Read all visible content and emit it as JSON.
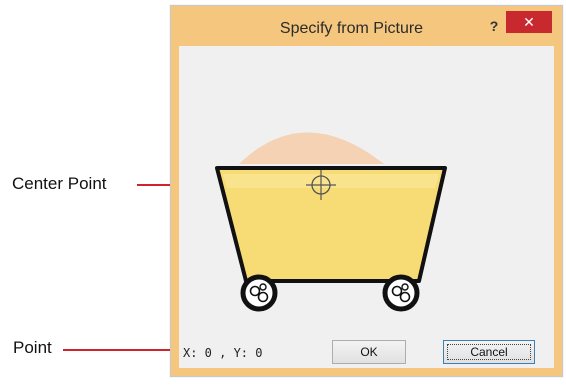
{
  "callouts": {
    "center_point": "Center Point",
    "point": "Point"
  },
  "dialog": {
    "title": "Specify from Picture",
    "help_label": "?",
    "close_label": "✕",
    "coordinates": "X: 0 , Y: 0",
    "ok_label": "OK",
    "cancel_label": "Cancel"
  },
  "colors": {
    "frame": "#f4c67e",
    "callout_line": "#d0232b",
    "close_button": "#c7292e",
    "cart_fill": "#f7dc76",
    "mound_fill": "#f5cda8"
  }
}
